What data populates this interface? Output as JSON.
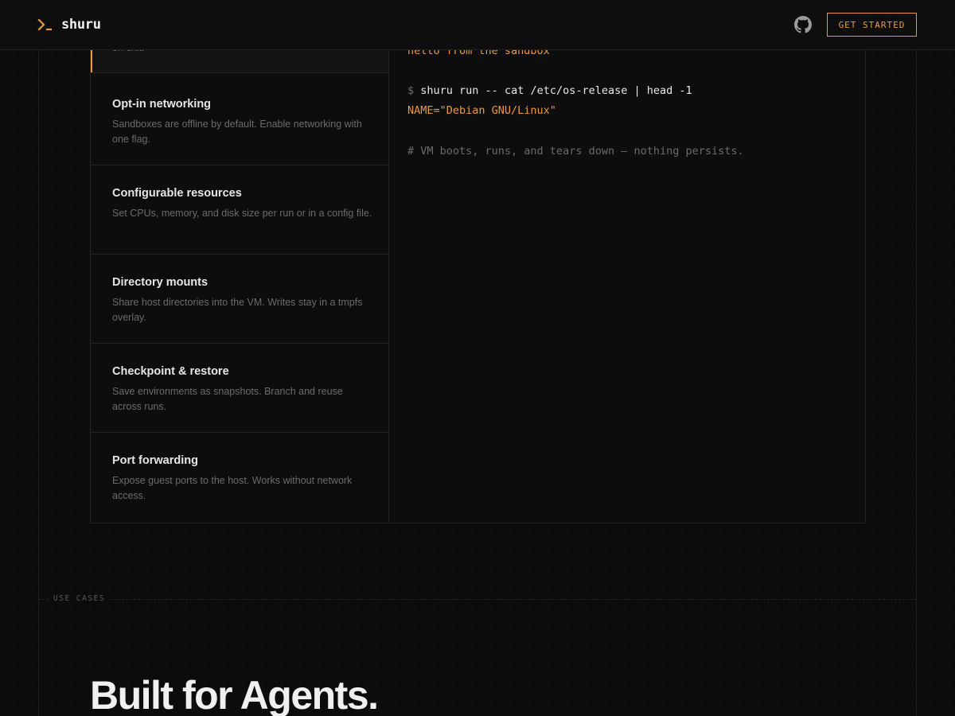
{
  "header": {
    "brand": "shuru",
    "github_icon": "github-icon",
    "cta_label": "GET STARTED"
  },
  "features": [
    {
      "title": "",
      "desc": "on exit."
    },
    {
      "title": "Opt-in networking",
      "desc": "Sandboxes are offline by default. Enable networking with one flag."
    },
    {
      "title": "Configurable resources",
      "desc": "Set CPUs, memory, and disk size per run or in a config file."
    },
    {
      "title": "Directory mounts",
      "desc": "Share host directories into the VM. Writes stay in a tmpfs overlay."
    },
    {
      "title": "Checkpoint & restore",
      "desc": "Save environments as snapshots. Branch and reuse across runs."
    },
    {
      "title": "Port forwarding",
      "desc": "Expose guest ports to the host. Works without network access."
    }
  ],
  "terminal": {
    "out1": "hello from the sandbox",
    "prompt": "$",
    "cmd2": "shuru run -- cat /etc/os-release | head -1",
    "out2": "NAME=\"Debian GNU/Linux\"",
    "comment": "# VM boots, runs, and tears down — nothing persists."
  },
  "use_cases": {
    "label": "USE CASES",
    "headline": "Built for Agents."
  },
  "colors": {
    "accent": "#e89a3c",
    "background": "#0c0c0c"
  }
}
